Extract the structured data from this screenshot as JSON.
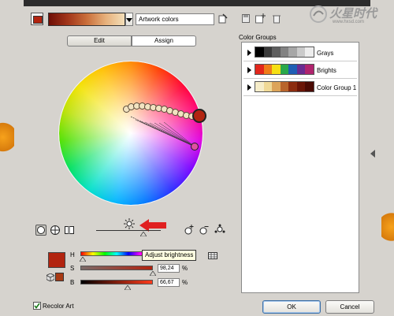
{
  "header": {
    "artwork_input": "Artwork colors",
    "artwork_gradient": [
      "#6e0e06",
      "#a2361a",
      "#c96e3a",
      "#e6b07a",
      "#f3deb8"
    ]
  },
  "tabs": {
    "edit": "Edit",
    "assign": "Assign"
  },
  "color_groups": {
    "title": "Color Groups",
    "items": [
      {
        "label": "Grays",
        "swatches": [
          "#000000",
          "#3a3a3a",
          "#5e5e5e",
          "#828282",
          "#a6a6a6",
          "#cacaca",
          "#ededed"
        ]
      },
      {
        "label": "Brights",
        "swatches": [
          "#e2261b",
          "#ef7c18",
          "#f5df14",
          "#2aa84a",
          "#1f5eb4",
          "#6a2b90",
          "#b0246e"
        ]
      },
      {
        "label": "Color Group 1",
        "swatches": [
          "#f6edc9",
          "#f0d996",
          "#dca45a",
          "#b9652c",
          "#8c2c0f",
          "#6a1507",
          "#4a0a04"
        ]
      }
    ]
  },
  "sliders": {
    "h_label": "H",
    "s_label": "S",
    "s_value": "98,24",
    "s_unit": "%",
    "b_label": "B",
    "b_value": "66,67",
    "b_unit": "%"
  },
  "tooltip": "Adjust brightness",
  "footer": {
    "recolor_art": "Recolor Art",
    "ok": "OK",
    "cancel": "Cancel"
  },
  "colors": {
    "base_color": "#b22410",
    "dialog_bg": "#d6d3ce",
    "annotation_arrow": "#e02020"
  },
  "watermark": {
    "text": "火星时代",
    "url": "www.hxsd.com"
  }
}
